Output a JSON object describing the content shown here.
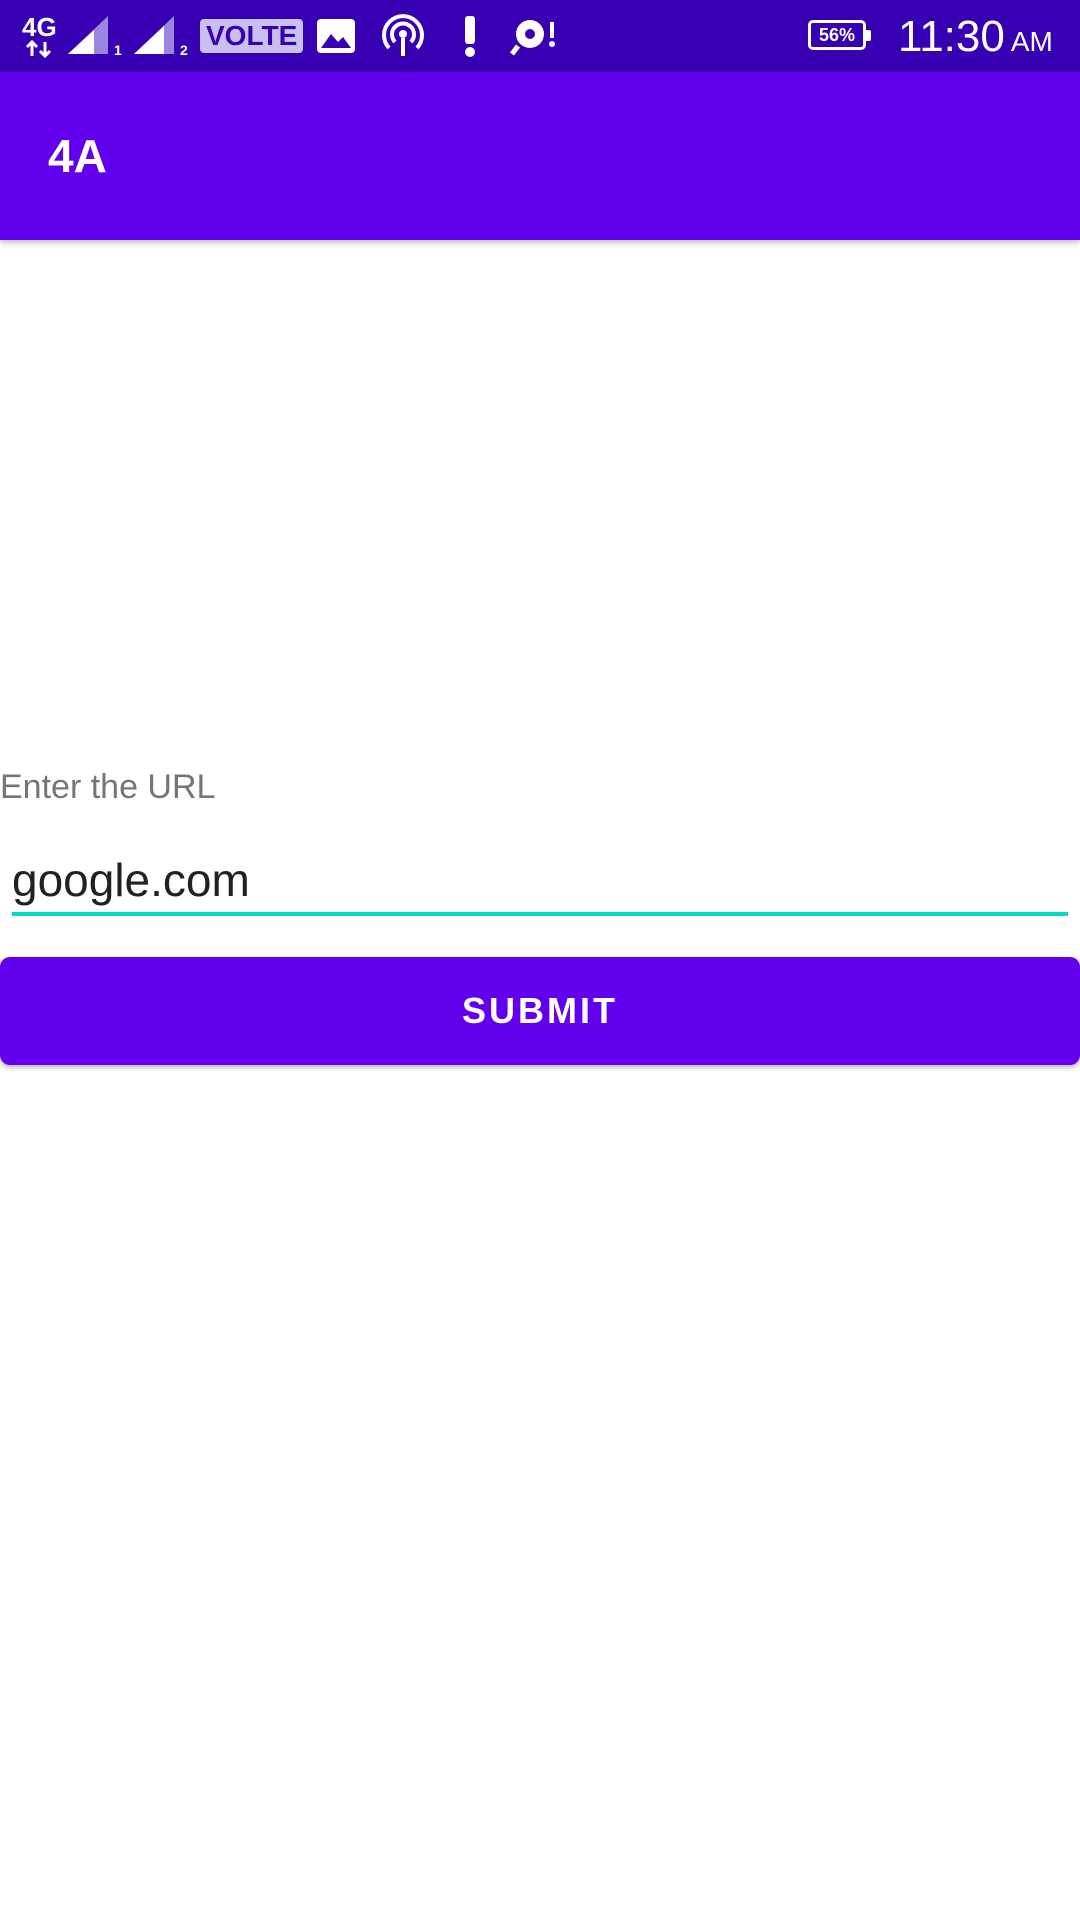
{
  "status_bar": {
    "network_type": "4G",
    "sim1_label": "1",
    "sim2_label": "2",
    "volte_label": "VOLTE",
    "battery_percent": "56%",
    "time": "11:30",
    "ampm": "AM",
    "icons": [
      "data-arrows-icon",
      "signal-sim1-icon",
      "signal-sim2-icon",
      "volte-icon",
      "image-icon",
      "hotspot-icon",
      "alert-icon",
      "sync-icon",
      "battery-icon"
    ]
  },
  "app_bar": {
    "title": "4A"
  },
  "form": {
    "label": "Enter the URL",
    "input_value": "google.com",
    "submit_label": "SUBMIT"
  },
  "colors": {
    "status_bar": "#3700b3",
    "primary": "#6200ee",
    "accent": "#03dac5"
  }
}
